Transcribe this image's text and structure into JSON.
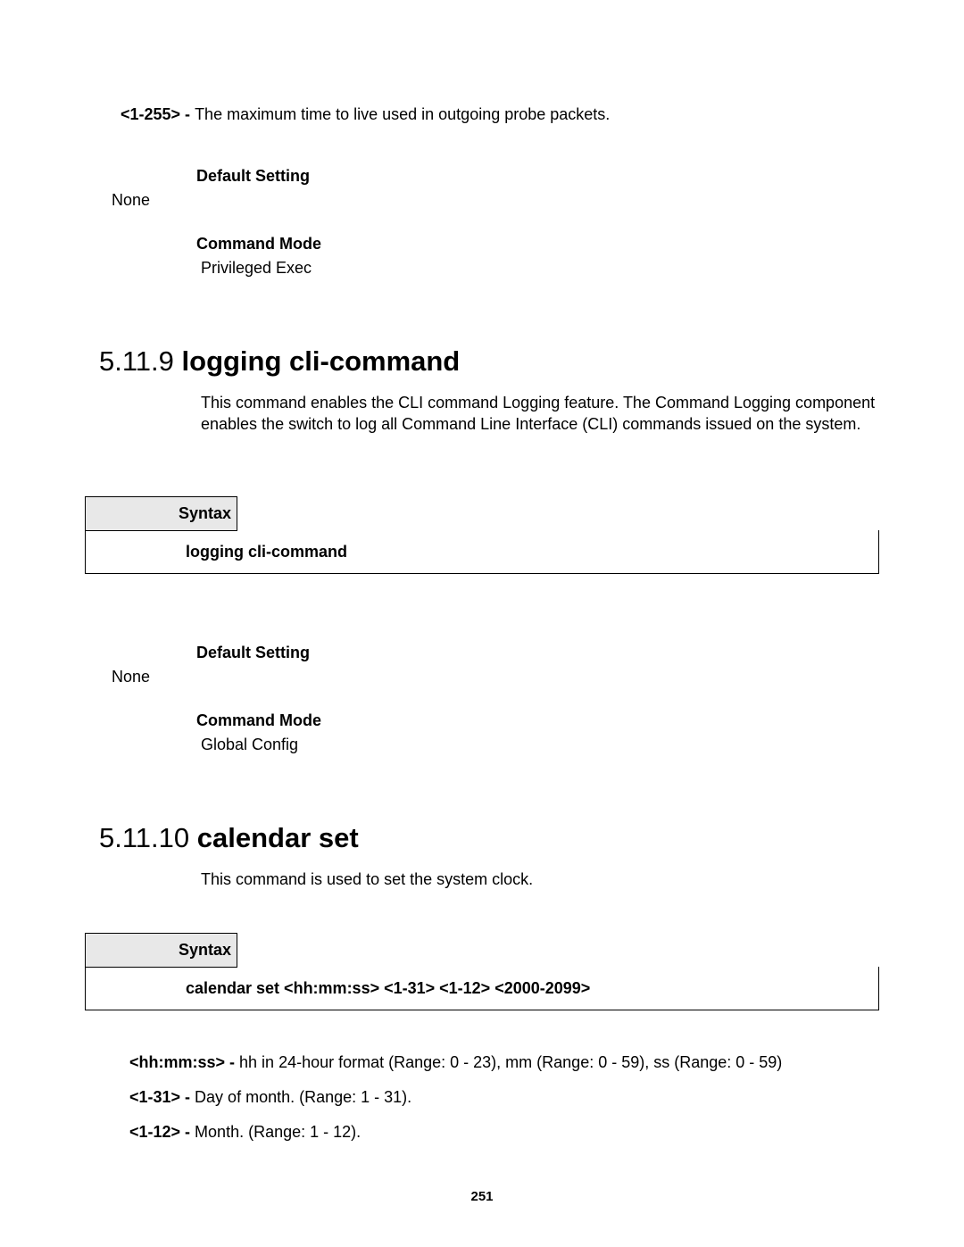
{
  "top_param": {
    "label": "<1-255> - ",
    "text": "The maximum time to live used in outgoing probe packets."
  },
  "default_setting_1": {
    "heading": "Default Setting",
    "value": "None"
  },
  "command_mode_1": {
    "heading": "Command Mode",
    "value": "Privileged Exec"
  },
  "section_5_11_9": {
    "number": "5.11.9 ",
    "title": "logging cli-command",
    "body": "This command enables the CLI command Logging feature. The Command Logging component enables the switch to log all Command Line Interface (CLI) commands issued on the system.",
    "syntax_label": "Syntax",
    "syntax_body": "logging cli-command"
  },
  "default_setting_2": {
    "heading": "Default Setting",
    "value": "None"
  },
  "command_mode_2": {
    "heading": "Command Mode",
    "value": "Global Config"
  },
  "section_5_11_10": {
    "number": "5.11.10 ",
    "title": "calendar set",
    "body": "This command is used to set the system clock.",
    "syntax_label": "Syntax",
    "syntax_body": "calendar set <hh:mm:ss> <1-31> <1-12> <2000-2099>"
  },
  "params": {
    "p1_label": "<hh:mm:ss> - ",
    "p1_text": "hh in 24-hour format (Range: 0 - 23), mm (Range: 0 - 59), ss (Range: 0 - 59)",
    "p2_label": "<1-31> - ",
    "p2_text": "Day of month. (Range: 1 - 31).",
    "p3_label": "<1-12> - ",
    "p3_text": "Month. (Range: 1 - 12)."
  },
  "page_number": "251"
}
